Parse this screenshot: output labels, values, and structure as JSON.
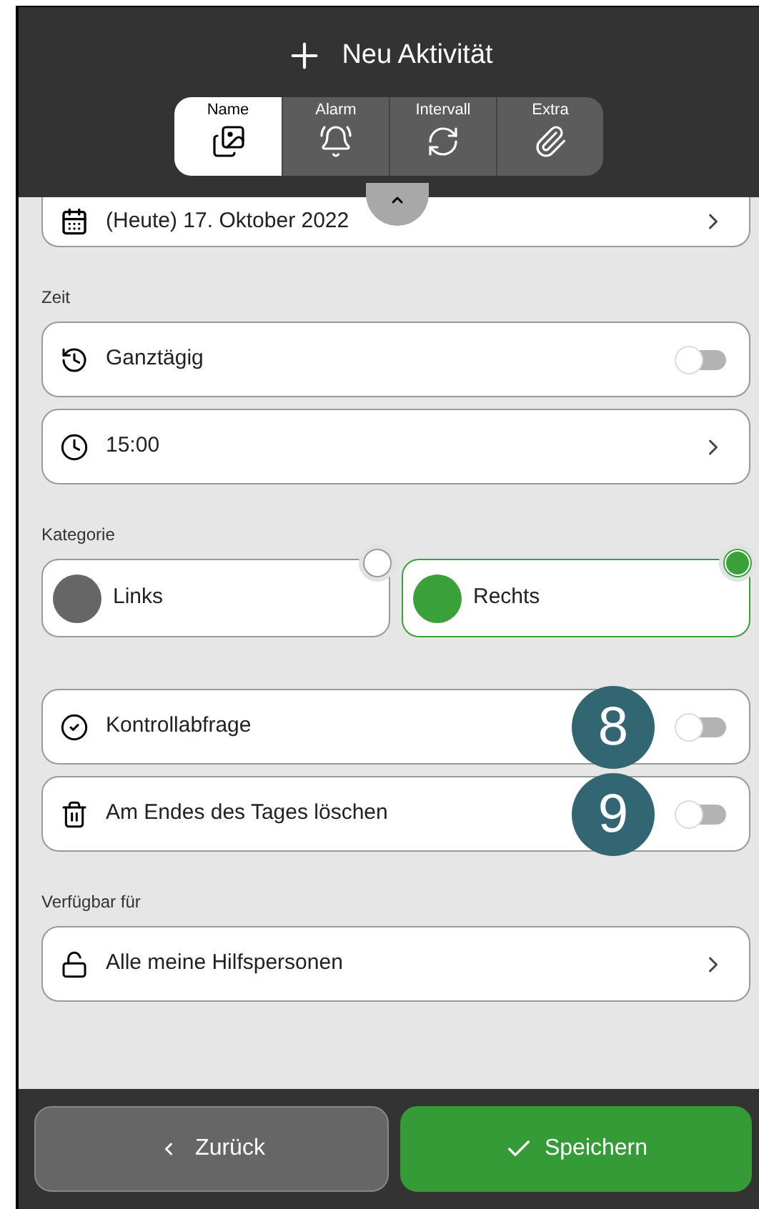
{
  "header": {
    "title": "Neu Aktivität"
  },
  "tabs": [
    {
      "label": "Name",
      "selected": true
    },
    {
      "label": "Alarm",
      "selected": false
    },
    {
      "label": "Intervall",
      "selected": false
    },
    {
      "label": "Extra",
      "selected": false
    }
  ],
  "date_row": {
    "label": "(Heute) 17. Oktober 2022"
  },
  "sections": [
    {
      "label": "Zeit",
      "kind": "rows",
      "rows": [
        {
          "kind": "toggle",
          "label": "Ganztägig",
          "on": false
        },
        {
          "kind": "link",
          "label": "15:00"
        }
      ]
    },
    {
      "label": "Kategorie",
      "kind": "categories",
      "categories": [
        {
          "label": "Links",
          "color": "#666666",
          "selected": false
        },
        {
          "label": "Rechts",
          "color": "#3aa03a",
          "selected": true
        }
      ]
    },
    {
      "kind": "rows",
      "rows": [
        {
          "kind": "toggle",
          "label": "Kontrollabfrage",
          "badge": "8",
          "on": false
        },
        {
          "kind": "toggle",
          "label": "Am Endes des Tages löschen",
          "badge": "9",
          "on": false
        }
      ]
    },
    {
      "label": "Verfügbar für",
      "kind": "rows",
      "rows": [
        {
          "kind": "link",
          "label": "Alle meine Hilfspersonen"
        }
      ]
    }
  ],
  "footer": {
    "back": "Zurück",
    "save": "Speichern"
  }
}
